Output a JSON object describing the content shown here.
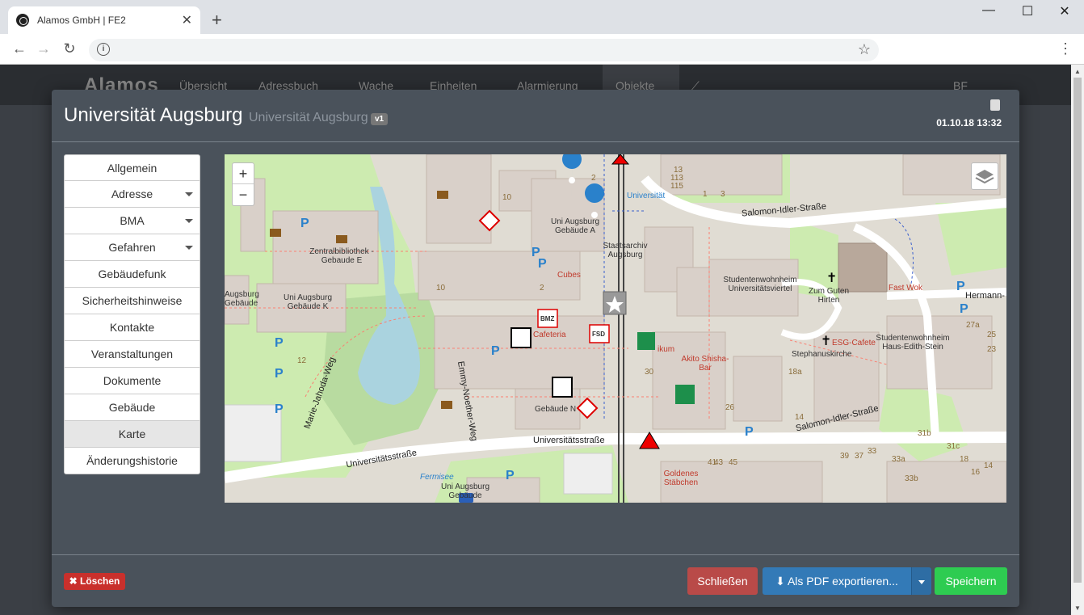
{
  "browser": {
    "tab_title": "Alamos GmbH | FE2",
    "tab_close": "✕",
    "new_tab": "+",
    "back": "←",
    "forward": "→",
    "reload": "↻",
    "info": "i",
    "bookmark": "☆",
    "menu": "⋮",
    "minimize": "—",
    "maximize": "☐",
    "close": "✕"
  },
  "app_nav": {
    "logo": "Alamos",
    "items": [
      "Übersicht",
      "Adressbuch",
      "Wache",
      "Einheiten",
      "Alarmierung",
      "Objekte"
    ],
    "user": "BF"
  },
  "modal": {
    "title": "Universität Augsburg",
    "subtitle": "Universität Augsburg",
    "version": "v1",
    "date": "01.10.18 13:32"
  },
  "sidebar": {
    "items": [
      {
        "label": "Allgemein",
        "dropdown": false
      },
      {
        "label": "Adresse",
        "dropdown": true
      },
      {
        "label": "BMA",
        "dropdown": true
      },
      {
        "label": "Gefahren",
        "dropdown": true
      },
      {
        "label": "Gebäudefunk",
        "dropdown": false
      },
      {
        "label": "Sicherheitshinweise",
        "dropdown": false
      },
      {
        "label": "Kontakte",
        "dropdown": false
      },
      {
        "label": "Veranstaltungen",
        "dropdown": false
      },
      {
        "label": "Dokumente",
        "dropdown": false
      },
      {
        "label": "Gebäude",
        "dropdown": false
      },
      {
        "label": "Karte",
        "dropdown": false,
        "active": true
      },
      {
        "label": "Änderungshistorie",
        "dropdown": false
      }
    ]
  },
  "map": {
    "zoom_in": "+",
    "zoom_out": "−",
    "labels": {
      "salomon_top": "Salomon-Idler-Straße",
      "salomon_bottom": "Salomon-Idler-Straße",
      "universitaetsstr_1": "Universitätsstraße",
      "universitaetsstr_2": "Universitätsstraße",
      "emmy": "Emmy-Noether-Weg",
      "marie": "Marie-Jahoda-Weg",
      "hermann": "Hermann-",
      "zentralbib": "Zentralbibliothek - Gebaude E",
      "uni_a": "Uni Augsburg Gebäude A",
      "uni_k": "Uni Augsburg Gebäude K",
      "uni_n": "Gebäude N",
      "uni_bottom": "Uni Augsburg Gebäude",
      "staatsarchiv": "Staatsarchiv Augsburg",
      "studentenwohnheim": "Studentenwohnheim Universitätsviertel",
      "zum_guten_hirten": "Zum Guten Hirten",
      "stephanuskirche": "Stephanuskirche",
      "esg": "ESG-Cafete",
      "fast_wok": "Fast Wok",
      "akito": "Akito Shisha-Bar",
      "goldenes": "Goldenes Stäbchen",
      "cubes": "Cubes",
      "cafeteria": "Cafeteria",
      "studentenwohnheim_haus": "Studentenwohnheim Haus-Edith-Stein",
      "fermisee": "Fermisee",
      "universitaet_tram": "Universität",
      "augsburg_left": "Augsburg Gebäude",
      "bmz": "BMZ",
      "fsd": "FSD",
      "ikum": "ikum"
    },
    "numbers": [
      "2",
      "10",
      "12",
      "10",
      "2",
      "13",
      "113",
      "115",
      "1",
      "3",
      "30",
      "26",
      "41",
      "43",
      "45",
      "39",
      "37",
      "33",
      "31b",
      "31c",
      "18",
      "14",
      "16",
      "33a",
      "33b",
      "27a",
      "25",
      "23",
      "18a",
      "14"
    ]
  },
  "footer": {
    "delete": "Löschen",
    "close": "Schließen",
    "export_pdf": "Als PDF exportieren...",
    "save": "Speichern"
  },
  "colors": {
    "modal_bg": "#4a525b",
    "map_building": "#d9d0c9",
    "map_green": "#cdebb0",
    "map_water": "#aad3df",
    "btn_danger": "#b94a48",
    "btn_primary": "#337ab7",
    "btn_success": "#2ecc51"
  }
}
